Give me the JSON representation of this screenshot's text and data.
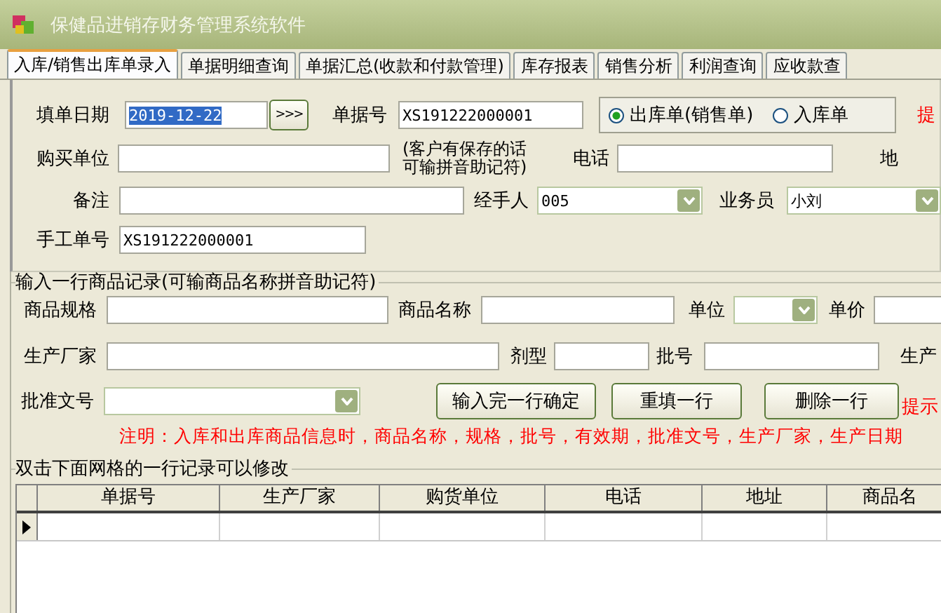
{
  "window": {
    "title": "保健品进销存财务管理系统软件"
  },
  "tabs": [
    {
      "label": "入库/销售出库单录入",
      "selected": true
    },
    {
      "label": "单据明细查询",
      "selected": false
    },
    {
      "label": "单据汇总(收款和付款管理)",
      "selected": false
    },
    {
      "label": "库存报表",
      "selected": false
    },
    {
      "label": "销售分析",
      "selected": false
    },
    {
      "label": "利润查询",
      "selected": false
    },
    {
      "label": "应收款查",
      "selected": false
    }
  ],
  "order_header": {
    "date": {
      "label": "填单日期",
      "value": "2019-12-22",
      "value_selected": true,
      "button": ">>>"
    },
    "doc_no": {
      "label": "单据号",
      "value": "XS191222000001"
    },
    "doc_type": [
      {
        "label": "出库单(销售单)",
        "selected": true
      },
      {
        "label": "入库单",
        "selected": false
      }
    ],
    "hint": "提",
    "buyer": {
      "label": "购买单位"
    },
    "buyer_note": [
      "(客户有保存的话",
      "可输拼音助记符)"
    ],
    "phone": {
      "label": "电话"
    },
    "address": {
      "label": "地"
    },
    "remark": {
      "label": "备注"
    },
    "handler": {
      "label": "经手人",
      "value": "005"
    },
    "salesman": {
      "label": "业务员",
      "value": "小刘"
    },
    "manual_no": {
      "label": "手工单号",
      "value": "XS191222000001"
    }
  },
  "item_entry": {
    "title": "输入一行商品记录(可输商品名称拼音助记符)",
    "spec": {
      "label": "商品规格"
    },
    "name": {
      "label": "商品名称"
    },
    "unit": {
      "label": "单位"
    },
    "price": {
      "label": "单价"
    },
    "maker": {
      "label": "生产厂家"
    },
    "form": {
      "label": "剂型"
    },
    "batch": {
      "label": "批号"
    },
    "made_date": {
      "label": "生产"
    },
    "approval": {
      "label": "批准文号"
    },
    "buttons": [
      "输入完一行确定",
      "重填一行",
      "删除一行"
    ],
    "hint": "提示",
    "note": "注明：入库和出库商品信息时，商品名称，规格，批号，有效期，批准文号，生产厂家，生产日期"
  },
  "grid": {
    "title": "双击下面网格的一行记录可以修改",
    "columns": [
      "单据号",
      "生产厂家",
      "购货单位",
      "电话",
      "地址",
      "商品名"
    ]
  }
}
